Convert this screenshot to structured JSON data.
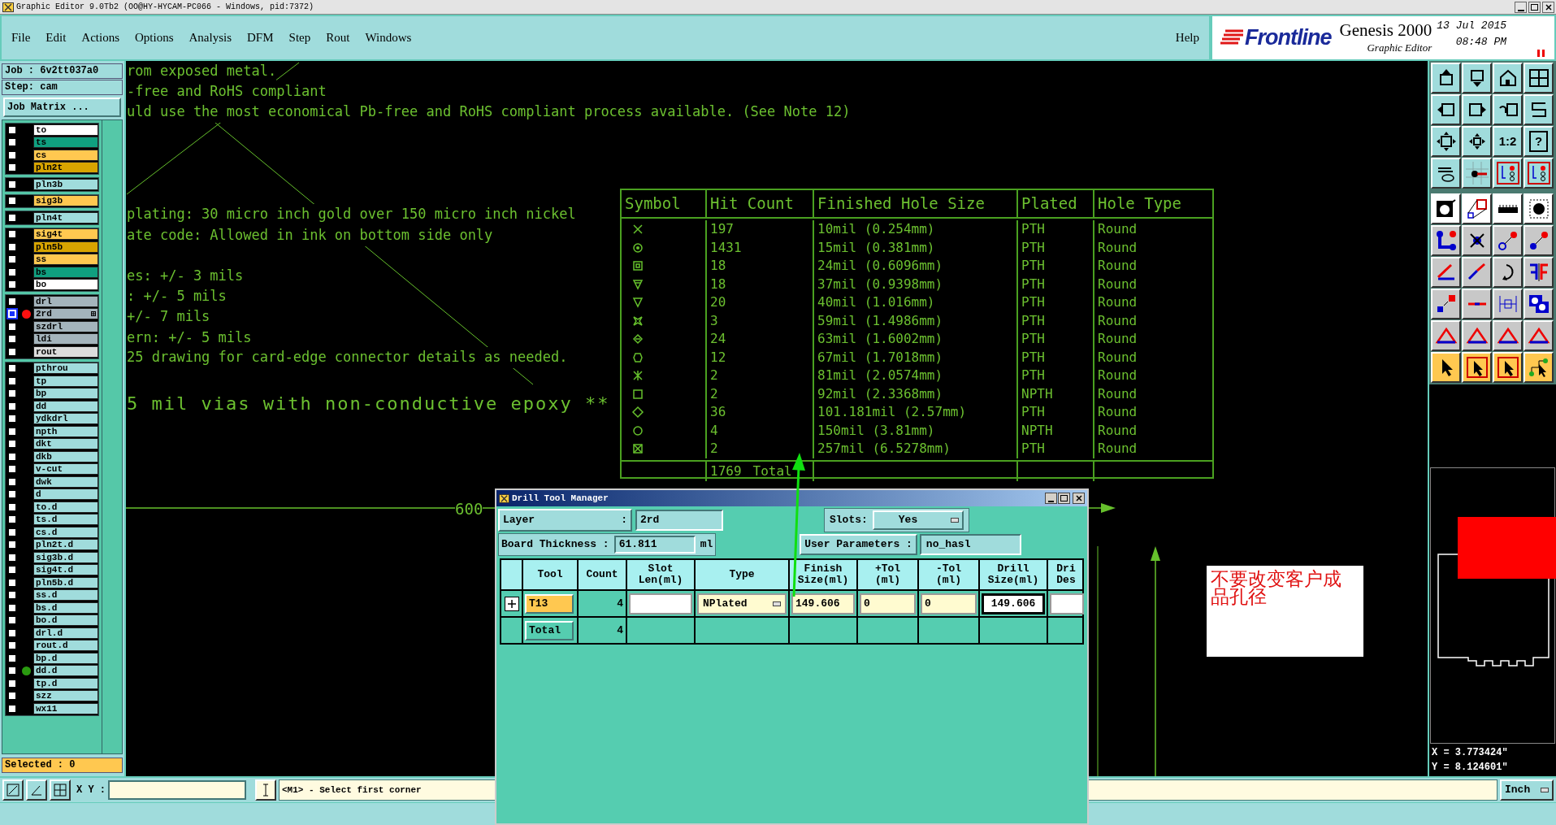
{
  "window": {
    "title": "Graphic Editor 9.0Tb2 (OO@HY-HYCAM-PC066 - Windows, pid:7372)"
  },
  "menu": [
    "File",
    "Edit",
    "Actions",
    "Options",
    "Analysis",
    "DFM",
    "Step",
    "Rout",
    "Windows"
  ],
  "help": "Help",
  "brand": {
    "logo": "Frontline",
    "product": "Genesis 2000",
    "subtitle": "Graphic Editor",
    "date": "13 Jul 2015",
    "time": "08:48 PM"
  },
  "job": {
    "job_label": "Job : 6v2tt037a0",
    "step": "Step: cam",
    "matrix_button": "Job Matrix ..."
  },
  "layer_groups": [
    {
      "layers": [
        {
          "name": "to",
          "color": "#ffffff",
          "selected": false
        },
        {
          "name": "ts",
          "color": "#10a080",
          "selected": false
        },
        {
          "name": "cs",
          "color": "#ffc850",
          "selected": false
        },
        {
          "name": "pln2t",
          "color": "#d8a400",
          "selected": false
        }
      ]
    },
    {
      "layers": [
        {
          "name": "pln3b",
          "color": "#a0dcdc",
          "selected": false
        }
      ]
    },
    {
      "layers": [
        {
          "name": "sig3b",
          "color": "#ffc850",
          "selected": false
        }
      ]
    },
    {
      "layers": [
        {
          "name": "pln4t",
          "color": "#a0dcdc",
          "selected": false
        }
      ]
    },
    {
      "layers": [
        {
          "name": "sig4t",
          "color": "#ffc850",
          "selected": false
        },
        {
          "name": "pln5b",
          "color": "#d8a400",
          "selected": false
        },
        {
          "name": "ss",
          "color": "#ffc850",
          "selected": false
        },
        {
          "name": "bs",
          "color": "#10a080",
          "selected": false
        },
        {
          "name": "bo",
          "color": "#ffffff",
          "selected": false
        }
      ]
    },
    {
      "layers": [
        {
          "name": "drl",
          "color": "#a4b4bc",
          "selected": false
        },
        {
          "name": "2rd",
          "color": "#a4b4bc",
          "selected": true,
          "status": {
            "color": "#ff1010"
          }
        },
        {
          "name": "szdrl",
          "color": "#a4b4bc",
          "selected": false
        },
        {
          "name": "ldi",
          "color": "#a4b4bc",
          "selected": false
        },
        {
          "name": "rout",
          "color": "#dcdcdc",
          "selected": false
        }
      ]
    },
    {
      "layers": [
        {
          "name": "pthrou",
          "color": "#a0dcdc",
          "selected": false
        },
        {
          "name": "tp",
          "color": "#a0dcdc",
          "selected": false
        },
        {
          "name": "bp",
          "color": "#a0dcdc",
          "selected": false
        },
        {
          "name": "dd",
          "color": "#a0dcdc",
          "selected": false
        },
        {
          "name": "ydkdrl",
          "color": "#a0dcdc",
          "selected": false
        },
        {
          "name": "npth",
          "color": "#a0dcdc",
          "selected": false
        },
        {
          "name": "dkt",
          "color": "#a0dcdc",
          "selected": false
        },
        {
          "name": "dkb",
          "color": "#a0dcdc",
          "selected": false
        },
        {
          "name": "v-cut",
          "color": "#a0dcdc",
          "selected": false
        },
        {
          "name": "dwk",
          "color": "#a0dcdc",
          "selected": false
        },
        {
          "name": "d",
          "color": "#a0dcdc",
          "selected": false
        },
        {
          "name": "to.d",
          "color": "#a0dcdc",
          "selected": false
        },
        {
          "name": "ts.d",
          "color": "#a0dcdc",
          "selected": false
        },
        {
          "name": "cs.d",
          "color": "#a0dcdc",
          "selected": false
        },
        {
          "name": "pln2t.d",
          "color": "#a0dcdc",
          "selected": false
        },
        {
          "name": "sig3b.d",
          "color": "#a0dcdc",
          "selected": false
        },
        {
          "name": "sig4t.d",
          "color": "#a0dcdc",
          "selected": false
        },
        {
          "name": "pln5b.d",
          "color": "#a0dcdc",
          "selected": false
        },
        {
          "name": "ss.d",
          "color": "#a0dcdc",
          "selected": false
        },
        {
          "name": "bs.d",
          "color": "#a0dcdc",
          "selected": false
        },
        {
          "name": "bo.d",
          "color": "#a0dcdc",
          "selected": false
        },
        {
          "name": "drl.d",
          "color": "#a0dcdc",
          "selected": false
        },
        {
          "name": "rout.d",
          "color": "#a0dcdc",
          "selected": false
        },
        {
          "name": "bp.d",
          "color": "#a0dcdc",
          "selected": false
        },
        {
          "name": "dd.d",
          "color": "#a0dcdc",
          "selected": false,
          "status": {
            "color": "#2a9a10"
          }
        },
        {
          "name": "tp.d",
          "color": "#a0dcdc",
          "selected": false
        },
        {
          "name": "szz",
          "color": "#a0dcdc",
          "selected": false
        },
        {
          "name": "wx11",
          "color": "#a0dcdc",
          "selected": false
        }
      ]
    }
  ],
  "selected_count": "Selected : 0",
  "canvas": {
    "notes": [
      {
        "text": "rom exposed metal.",
        "kind": "normal"
      },
      {
        "text": "-free and RoHS compliant",
        "kind": "normal"
      },
      {
        "text": "uld use the most economical Pb-free and RoHS compliant process available. (See Note 12)",
        "kind": "normal"
      },
      {
        "text": "plating: 30 micro inch gold over 150 micro inch nickel",
        "kind": "normal"
      },
      {
        "text": "ate code: Allowed in ink on bottom side only",
        "kind": "normal"
      },
      {
        "text": "es: +/- 3 mils",
        "kind": "normal"
      },
      {
        "text": ": +/- 5 mils",
        "kind": "normal"
      },
      {
        "text": "+/- 7 mils",
        "kind": "normal"
      },
      {
        "text": "ern: +/- 5 mils",
        "kind": "normal"
      },
      {
        "text": "25 drawing for card-edge connector details as needed.",
        "kind": "normal"
      },
      {
        "text": "5 mil vias with non-conductive epoxy **",
        "kind": "large"
      }
    ],
    "dimension": "600",
    "drill_table": {
      "columns": [
        "Symbol",
        "Hit Count",
        "Finished Hole Size",
        "Plated",
        "Hole Type"
      ],
      "rows": [
        [
          "",
          "197",
          "10mil (0.254mm)",
          "PTH",
          "Round"
        ],
        [
          "",
          "1431",
          "15mil (0.381mm)",
          "PTH",
          "Round"
        ],
        [
          "",
          "18",
          "24mil (0.6096mm)",
          "PTH",
          "Round"
        ],
        [
          "",
          "18",
          "37mil (0.9398mm)",
          "PTH",
          "Round"
        ],
        [
          "",
          "20",
          "40mil (1.016mm)",
          "PTH",
          "Round"
        ],
        [
          "",
          "3",
          "59mil (1.4986mm)",
          "PTH",
          "Round"
        ],
        [
          "",
          "24",
          "63mil (1.6002mm)",
          "PTH",
          "Round"
        ],
        [
          "",
          "12",
          "67mil (1.7018mm)",
          "PTH",
          "Round"
        ],
        [
          "",
          "2",
          "81mil (2.0574mm)",
          "PTH",
          "Round"
        ],
        [
          "",
          "2",
          "92mil (2.3368mm)",
          "NPTH",
          "Round"
        ],
        [
          "",
          "36",
          "101.181mil (2.57mm)",
          "PTH",
          "Round"
        ],
        [
          "",
          "4",
          "150mil (3.81mm)",
          "NPTH",
          "Round"
        ],
        [
          "",
          "2",
          "257mil (6.5278mm)",
          "PTH",
          "Round"
        ]
      ],
      "total": {
        "count": "1769",
        "label": "Total"
      }
    },
    "annotation": "不要改变客户成品孔径"
  },
  "toolbar": {
    "ratio_label": "1:2",
    "help_label": "?"
  },
  "coordinates": {
    "x": "X = 3.773424\"",
    "y": "Y = 8.124601\""
  },
  "bottom_bar": {
    "xy_label": "X Y :",
    "prompt": "<M1> - Select first corner",
    "units": "Inch"
  },
  "dialog": {
    "title": "Drill Tool Manager",
    "layer": {
      "label": "Layer",
      "separator": ":",
      "value": "2rd"
    },
    "slots": {
      "label": "Slots:",
      "value": "Yes"
    },
    "board_thickness": {
      "label": "Board Thickness :",
      "value": "61.811",
      "unit": "ml"
    },
    "user_parameters": {
      "label": "User Parameters :",
      "value": "no_hasl"
    },
    "columns": [
      "Tool",
      "Count",
      "Slot\nLen(ml)",
      "Type",
      "Finish\nSize(ml)",
      "+Tol\n(ml)",
      "-Tol\n(ml)",
      "Drill\nSize(ml)",
      "Dri\nDes"
    ],
    "tools": [
      {
        "tool": "T13",
        "count": "4",
        "type": "NPlated",
        "finish_size": "149.606",
        "plus_tol": "0",
        "minus_tol": "0",
        "drill_size": "149.606"
      }
    ],
    "total": {
      "label": "Total",
      "count": "4"
    }
  }
}
